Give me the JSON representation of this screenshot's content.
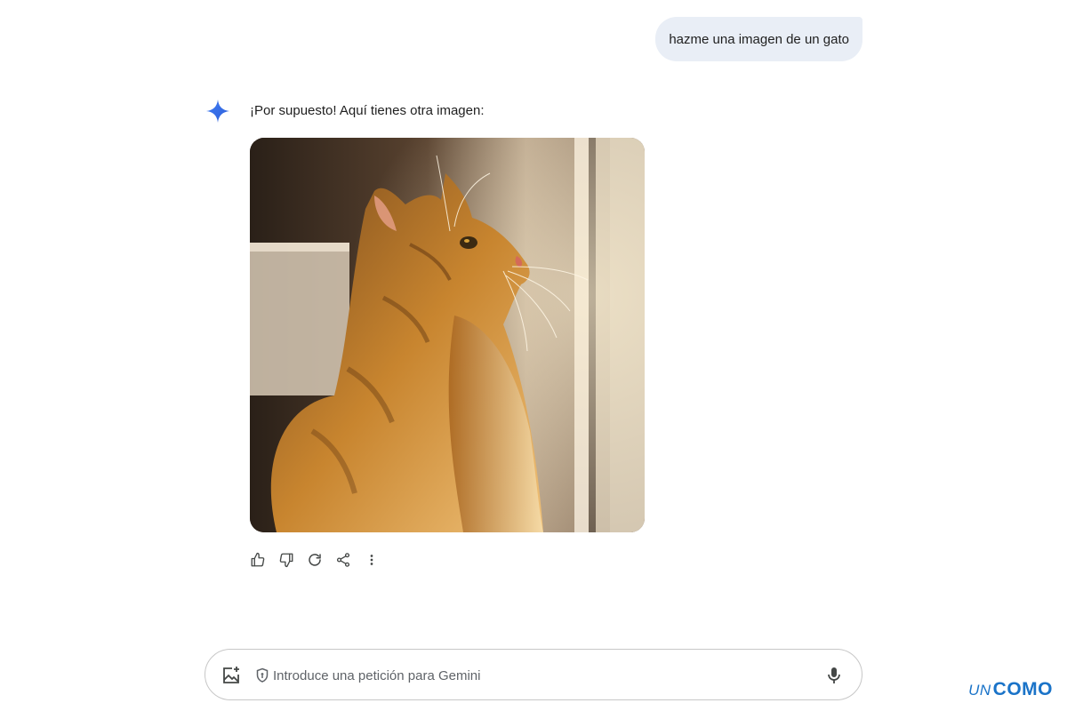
{
  "conversation": {
    "user_message": "hazme una imagen de un gato",
    "response_text": "¡Por supuesto! Aquí tienes otra imagen:"
  },
  "response_actions": [
    {
      "name": "thumbs-up-icon",
      "label": "Buena respuesta"
    },
    {
      "name": "thumbs-down-icon",
      "label": "Mala respuesta"
    },
    {
      "name": "refresh-icon",
      "label": "Regenerar"
    },
    {
      "name": "share-icon",
      "label": "Compartir"
    },
    {
      "name": "more-vertical-icon",
      "label": "Más"
    }
  ],
  "input": {
    "placeholder": "Introduce una petición para Gemini",
    "value": ""
  },
  "watermark": {
    "prefix": "UN",
    "brand": "COMO"
  },
  "colors": {
    "user_bubble_bg": "#e9eef6",
    "gemini_blue": "#4285f4",
    "watermark_blue": "#1a73c8"
  }
}
